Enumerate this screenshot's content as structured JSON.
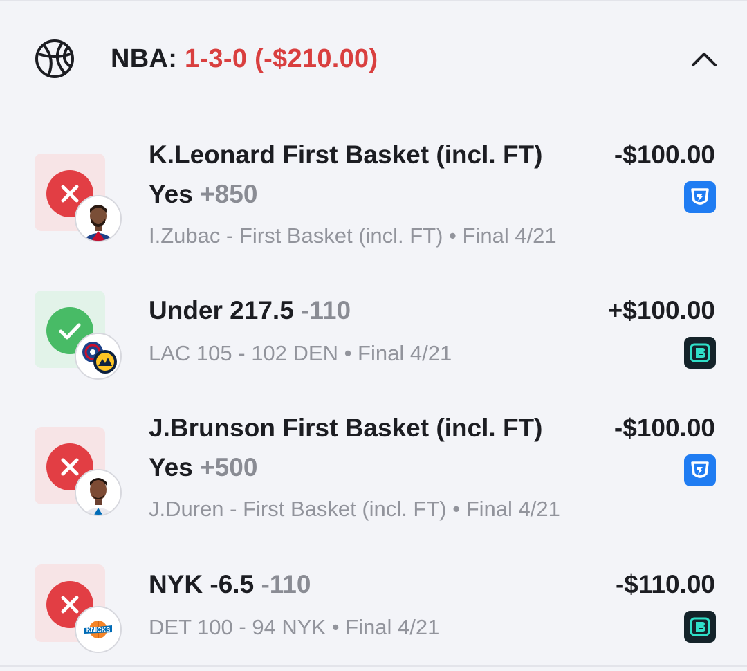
{
  "header": {
    "icon": "basketball-icon",
    "label": "NBA:",
    "record": "1-3-0 (-$210.00)",
    "record_color": "#d93f3f",
    "toggle_icon": "chevron-up-icon"
  },
  "bets": [
    {
      "result": "loss",
      "title": "K.Leonard First Basket (incl. FT)",
      "line2_label": "Yes",
      "odds": "+850",
      "subtitle": "I.Zubac - First Basket (incl. FT) • Final 4/21",
      "amount": "-$100.00",
      "book": "fanduel-logo-icon",
      "avatar": "player-avatar-k-leonard"
    },
    {
      "result": "win",
      "title": "Under 217.5",
      "odds": "-110",
      "subtitle": "LAC 105 - 102 DEN • Final 4/21",
      "amount": "+$100.00",
      "book": "espn-bet-logo-icon",
      "avatar": "team-logos-lac-den"
    },
    {
      "result": "loss",
      "title": "J.Brunson First Basket (incl. FT)",
      "line2_label": "Yes",
      "odds": "+500",
      "subtitle": "J.Duren - First Basket (incl. FT) • Final 4/21",
      "amount": "-$100.00",
      "book": "fanduel-logo-icon",
      "avatar": "player-avatar-j-brunson"
    },
    {
      "result": "loss",
      "title": "NYK -6.5",
      "odds": "-110",
      "subtitle": "DET 100 - 94 NYK • Final 4/21",
      "amount": "-$110.00",
      "book": "espn-bet-logo-icon",
      "avatar": "team-logo-nyk"
    }
  ],
  "colors": {
    "loss": "#e23e44",
    "win": "#48bb66",
    "fanduel": "#1f7cf2",
    "espn_bet": "#14232a"
  }
}
